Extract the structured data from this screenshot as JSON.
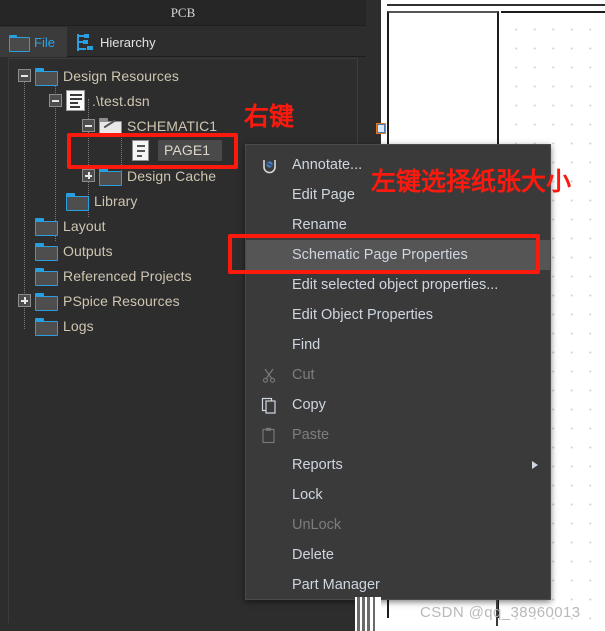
{
  "window": {
    "title": "PCB"
  },
  "tabs": [
    {
      "label": "File",
      "icon": "folder-icon",
      "active": true
    },
    {
      "label": "Hierarchy",
      "icon": "hierarchy-icon",
      "active": false
    }
  ],
  "tree": [
    {
      "label": "Design Resources",
      "icon": "folder-icon",
      "expander": "minus",
      "depth": 0
    },
    {
      "label": ".\\test.dsn",
      "icon": "dsn-file-icon",
      "expander": "minus",
      "depth": 1
    },
    {
      "label": "SCHEMATIC1",
      "icon": "schematic-folder-icon",
      "expander": "minus",
      "depth": 2
    },
    {
      "label": "PAGE1",
      "icon": "page-icon",
      "expander": "none",
      "depth": 3,
      "selected": true
    },
    {
      "label": "Design Cache",
      "icon": "folder-icon",
      "expander": "plus",
      "depth": 2
    },
    {
      "label": "Library",
      "icon": "folder-icon",
      "expander": "none",
      "depth": 1
    },
    {
      "label": "Layout",
      "icon": "folder-icon",
      "expander": "none",
      "depth": 0
    },
    {
      "label": "Outputs",
      "icon": "folder-icon",
      "expander": "none",
      "depth": 0
    },
    {
      "label": "Referenced Projects",
      "icon": "folder-icon",
      "expander": "none",
      "depth": 0
    },
    {
      "label": "PSpice Resources",
      "icon": "folder-icon",
      "expander": "plus",
      "depth": 0
    },
    {
      "label": "Logs",
      "icon": "folder-icon",
      "expander": "none",
      "depth": 0
    }
  ],
  "context_menu": {
    "items": [
      {
        "label": "Annotate...",
        "icon": "annotate-icon",
        "state": "normal"
      },
      {
        "label": "Edit Page",
        "icon": "",
        "state": "normal"
      },
      {
        "label": "Rename",
        "icon": "",
        "state": "normal"
      },
      {
        "label": "Schematic Page Properties",
        "icon": "",
        "state": "highlighted"
      },
      {
        "label": "Edit selected object properties...",
        "icon": "",
        "state": "normal"
      },
      {
        "label": "Edit Object Properties",
        "icon": "",
        "state": "normal"
      },
      {
        "label": "Find",
        "icon": "",
        "state": "normal"
      },
      {
        "label": "Cut",
        "icon": "scissors-icon",
        "state": "disabled"
      },
      {
        "label": "Copy",
        "icon": "copy-icon",
        "state": "normal"
      },
      {
        "label": "Paste",
        "icon": "paste-icon",
        "state": "disabled"
      },
      {
        "label": "Reports",
        "icon": "",
        "state": "normal",
        "submenu": true
      },
      {
        "label": "Lock",
        "icon": "",
        "state": "normal"
      },
      {
        "label": "UnLock",
        "icon": "",
        "state": "disabled"
      },
      {
        "label": "Delete",
        "icon": "",
        "state": "normal"
      },
      {
        "label": "Part Manager",
        "icon": "",
        "state": "normal"
      }
    ]
  },
  "annotations": [
    {
      "id": "right-click-note",
      "text": "右键",
      "color": "#fc1a0f"
    },
    {
      "id": "paper-size-note",
      "text": "左键选择纸张大小",
      "color": "#fc1a0f"
    }
  ],
  "watermark": {
    "text": "CSDN @qq_38960013"
  },
  "colors": {
    "accent_blue": "#2a9fe0",
    "panel_bg": "#2d2d2d",
    "menu_bg": "#3a3a3a",
    "highlight": "#555555",
    "tree_text": "#cfc6b2",
    "annotation_red": "#fc1a0f"
  }
}
